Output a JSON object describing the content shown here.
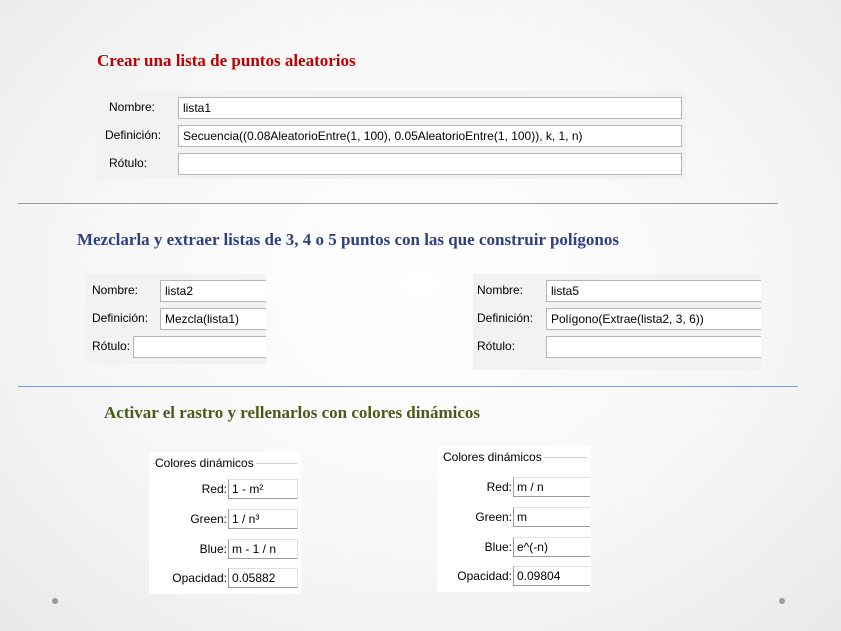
{
  "headings": {
    "h1": "Crear una lista de puntos aleatorios",
    "h2": "Mezclarla y extraer listas de 3, 4 o 5 puntos con las que construir polígonos",
    "h3": "Activar el rastro y rellenarlos con colores dinámicos"
  },
  "colors": {
    "h1": "#c00000",
    "h2": "#2f3f7f",
    "h3": "#4a5a1a"
  },
  "labels": {
    "nombre": "Nombre:",
    "definicion": "Definición:",
    "rotulo": "Rótulo:"
  },
  "panel1": {
    "nombre": "lista1",
    "definicion": "Secuencia((0.08AleatorioEntre(1, 100), 0.05AleatorioEntre(1, 100)), k, 1, n)",
    "rotulo": ""
  },
  "panel2": {
    "nombre": "lista2",
    "definicion": "Mezcla(lista1)",
    "rotulo": ""
  },
  "panel3": {
    "nombre": "lista5",
    "definicion": "Polígono(Extrae(lista2, 3, 6))",
    "rotulo": ""
  },
  "colores_labels": {
    "legend": "Colores dinámicos",
    "red": "Red:",
    "green": "Green:",
    "blue": "Blue:",
    "opacidad": "Opacidad:"
  },
  "colores1": {
    "red": "1 - m²",
    "green": "1 / n³",
    "blue": "m - 1 / n",
    "opacidad": "0.05882"
  },
  "colores2": {
    "red": "m / n",
    "green": "m",
    "blue": "e^(-n)",
    "opacidad": "0.09804"
  }
}
